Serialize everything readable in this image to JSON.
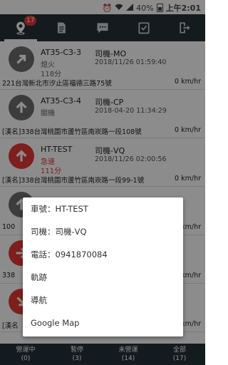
{
  "statusbar": {
    "battery": "40%",
    "time": "上午2:01"
  },
  "tabs": [
    {
      "icon": "map-pin-icon",
      "badge": "17",
      "active": true
    },
    {
      "icon": "document-icon"
    },
    {
      "icon": "chat-icon"
    },
    {
      "icon": "checklist-icon"
    },
    {
      "icon": "logout-icon"
    }
  ],
  "vehicles": [
    {
      "plate": "AT35-C3-3",
      "driver": "司機-MO",
      "status": "熄火",
      "time": "2018/11/26 01:59:40",
      "duration": "118分",
      "address": "221台灣新北市汐止區福德三路75號",
      "speed": "0 km/hr",
      "color": "#6d6d6d",
      "icon": "arrow-up-right-icon"
    },
    {
      "plate": "AT35-C3-4",
      "driver": "司機-CP",
      "status": "關機",
      "time": "2018-04-20 11:34:29",
      "duration": "",
      "address": "[漢名]338台灣桃園市蘆竹區南崁路一段108號",
      "speed": "0 km/hr",
      "color": "#6d6d6d",
      "icon": "arrow-up-icon"
    },
    {
      "plate": "HT-TEST",
      "driver": "司機-VQ",
      "status": "急速",
      "time": "2018/11/26 02:00:56",
      "duration": "111分",
      "address": "[漢名]338台灣桃園市蘆竹區南崁路一段99-1號",
      "speed": "0 km/hr",
      "color": "#e53935",
      "icon": "arrow-up-icon"
    },
    {
      "plate": "",
      "driver": "",
      "status": "",
      "time": "",
      "duration": "",
      "address": "100",
      "speed": "0 km/hr",
      "color": "#6d6d6d",
      "icon": "arrow-up-icon"
    },
    {
      "plate": "",
      "driver": "",
      "status": "",
      "time": "",
      "duration": "",
      "address": "338",
      "speed": "0 km/hr",
      "color": "#e53935",
      "icon": "arrow-right-icon"
    },
    {
      "plate": "",
      "driver": "",
      "status": "",
      "time": "",
      "duration": "",
      "address": "[漢名",
      "speed": "0 km/hr",
      "color": "#e53935",
      "icon": "arrow-down-right-icon"
    }
  ],
  "popup": {
    "plate": "車號：HT-TEST",
    "driver": "司機：司機-VQ",
    "phone": "電話：0941870084",
    "track": "軌跡",
    "navigate": "導航",
    "googlemap": "Google Map"
  },
  "bottomnav": [
    {
      "label": "營運中",
      "count": "(0)"
    },
    {
      "label": "暫停",
      "count": "(3)"
    },
    {
      "label": "未營運",
      "count": "(14)"
    },
    {
      "label": "全部",
      "count": "(17)"
    }
  ]
}
